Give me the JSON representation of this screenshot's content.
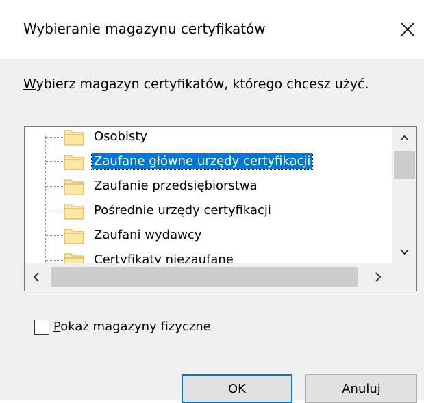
{
  "window": {
    "title": "Wybieranie magazynu certyfikatów",
    "close_icon": "close-icon"
  },
  "prompt": {
    "mnemonic": "W",
    "rest": "ybierz magazyn certyfikatów, którego chcesz użyć."
  },
  "tree": {
    "items": [
      {
        "label": "Osobisty",
        "selected": false
      },
      {
        "label": "Zaufane główne urzędy certyfikacji",
        "selected": true
      },
      {
        "label": "Zaufanie przedsiębiorstwa",
        "selected": false
      },
      {
        "label": "Pośrednie urzędy certyfikacji",
        "selected": false
      },
      {
        "label": "Zaufani wydawcy",
        "selected": false
      },
      {
        "label": "Certyfikaty niezaufane",
        "selected": false
      }
    ],
    "folder_icon": "folder-icon",
    "folder_colors": {
      "fill": "#fce8a4",
      "stroke": "#d8a93a"
    },
    "selection_color": "#0078d7"
  },
  "checkbox": {
    "mnemonic": "P",
    "rest": "okaż magazyny fizyczne",
    "checked": false
  },
  "buttons": {
    "ok": "OK",
    "cancel": "Anuluj"
  }
}
